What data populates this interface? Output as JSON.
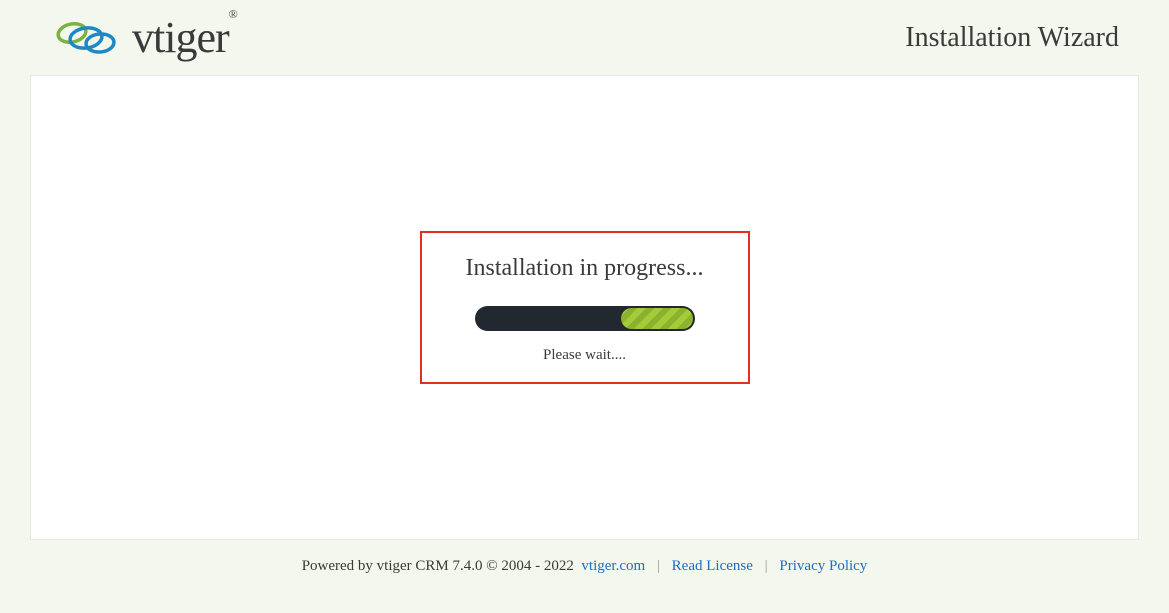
{
  "header": {
    "logo_text": "vtiger",
    "wizard_title": "Installation Wizard"
  },
  "progress": {
    "title": "Installation in progress...",
    "wait_text": "Please wait...."
  },
  "footer": {
    "powered_by": "Powered by vtiger CRM 7.4.0  © 2004 - 2022",
    "link_vtiger": "vtiger.com",
    "link_license": "Read License",
    "link_privacy": "Privacy Policy",
    "separator": "|"
  }
}
